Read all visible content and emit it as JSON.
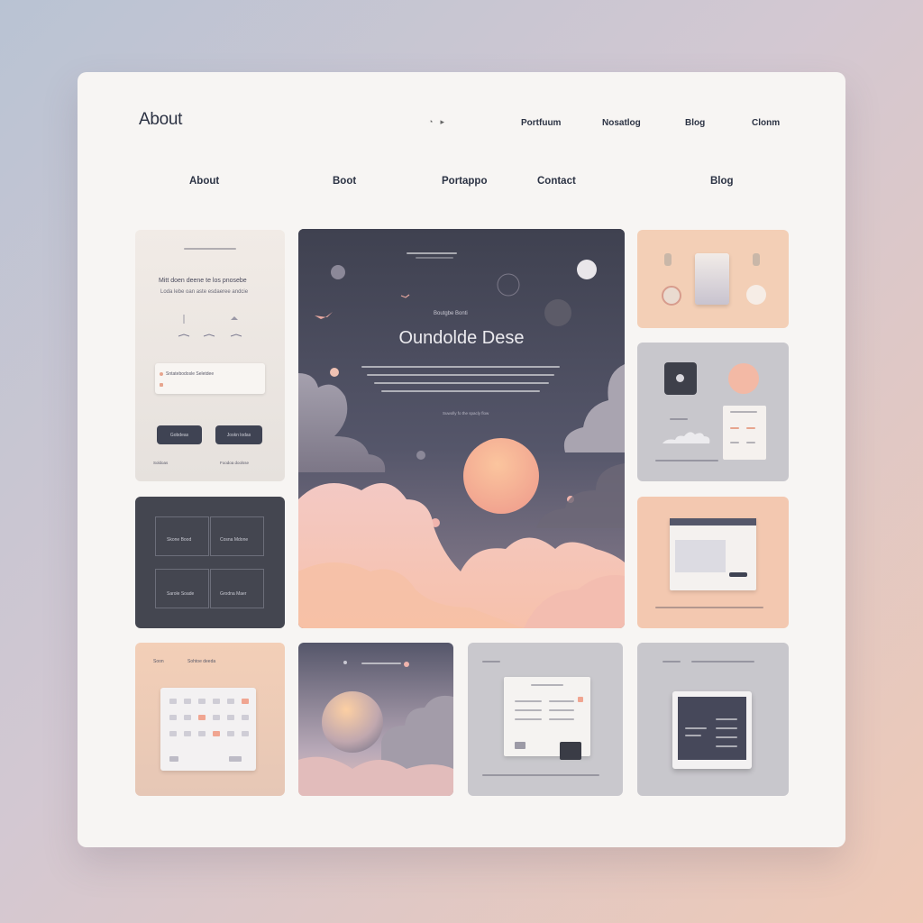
{
  "header": {
    "logo": "About",
    "icons": [
      "cursor-icon",
      "dot-icon"
    ],
    "nav": [
      "Portfuum",
      "Nosatlog",
      "Blog",
      "Clonm"
    ]
  },
  "subnav": [
    "About",
    "Boot",
    "Portappo",
    "Contact",
    "Blog"
  ],
  "hero": {
    "eyebrow": "Boutgbe Bonti",
    "title": "Oundolde Dese",
    "tagline": "Suwolly fo the spacly flow"
  },
  "left_card": {
    "title": "Mitt doen deene te los pnosebe",
    "subtitle": "Loda lebe oan aste esdaeree andcie",
    "input_text": "Sntatebodosle Seletdee",
    "button_primary": "Gobdeas",
    "button_secondary": "Joskn lodas",
    "footer_left": "Soldoas",
    "footer_right": "Foodoa doolsse"
  },
  "dark_grid_card": {
    "cells": [
      "Skone Bood",
      "Cosna Mdone",
      "Sarole Soade",
      "Grodna Maer"
    ]
  },
  "calendar_card": {
    "label": "Soon",
    "heading": "Sohtoe deeda"
  },
  "colors": {
    "accent_peach": "#f2c6ad",
    "dark_panel": "#454854",
    "grey_panel": "#c7c6cb",
    "text_dark": "#2c3344"
  }
}
